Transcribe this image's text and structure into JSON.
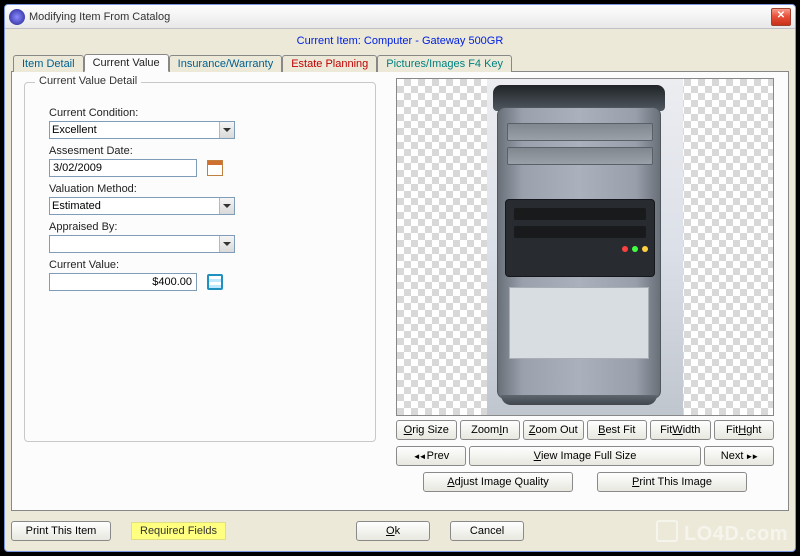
{
  "window": {
    "title": "Modifying Item From Catalog",
    "close_tooltip": "Close"
  },
  "banner": {
    "label": "Current Item: Computer - Gateway 500GR"
  },
  "tabs": [
    {
      "label": "Item Detail",
      "color": "c-blue",
      "active": false
    },
    {
      "label": "Current Value",
      "color": "c-black",
      "active": true
    },
    {
      "label": "Insurance/Warranty",
      "color": "c-blue",
      "active": false
    },
    {
      "label": "Estate Planning",
      "color": "c-red",
      "active": false
    },
    {
      "label": "Pictures/Images  F4 Key",
      "color": "c-teal",
      "active": false
    }
  ],
  "groupbox": {
    "title": "Current Value Detail"
  },
  "fields": {
    "condition": {
      "label": "Current Condition:",
      "value": "Excellent"
    },
    "assessment": {
      "label": "Assesment Date:",
      "value": "3/02/2009"
    },
    "valuation": {
      "label": "Valuation Method:",
      "value": "Estimated"
    },
    "appraised": {
      "label": "Appraised By:",
      "value": ""
    },
    "current": {
      "label": "Current Value:",
      "value": "$400.00"
    }
  },
  "image_buttons": {
    "row1": [
      "Orig Size",
      "Zoom In",
      "Zoom Out",
      "Best Fit",
      "Fit Width",
      "Fit Hght"
    ],
    "prev": "Prev",
    "view_full": "View Image Full Size",
    "next": "Next",
    "adjust": "Adjust Image Quality",
    "print_image": "Print This Image"
  },
  "bottom": {
    "print_item": "Print This Item",
    "required": "Required Fields",
    "ok": "Ok",
    "cancel": "Cancel"
  },
  "watermark": "LO4D.com"
}
